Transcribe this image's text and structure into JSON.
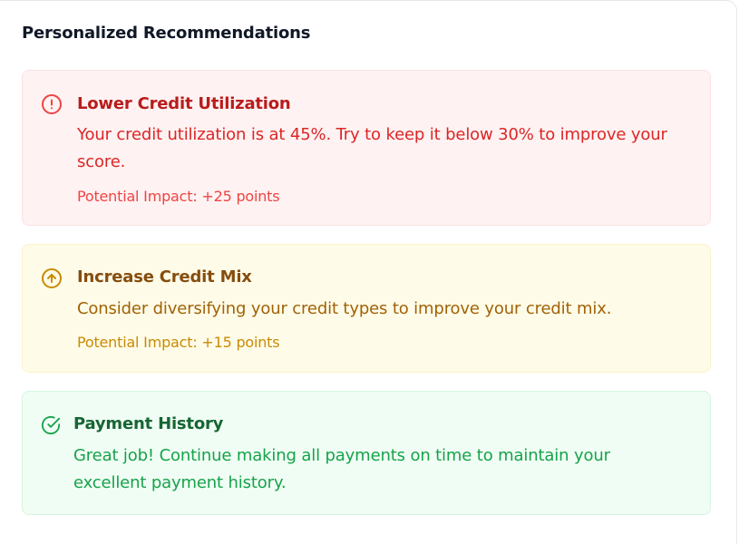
{
  "section": {
    "title": "Personalized Recommendations"
  },
  "recommendations": [
    {
      "icon": "alert-circle-icon",
      "title": "Lower Credit Utilization",
      "description": "Your credit utilization is at 45%. Try to keep it below 30% to improve your score.",
      "impact": "Potential Impact: +25 points",
      "color": "#dc2626"
    },
    {
      "icon": "arrow-up-circle-icon",
      "title": "Increase Credit Mix",
      "description": "Consider diversifying your credit types to improve your credit mix.",
      "impact": "Potential Impact: +15 points",
      "color": "#ca8a04"
    },
    {
      "icon": "check-circle-icon",
      "title": "Payment History",
      "description": "Great job! Continue making all payments on time to maintain your excellent payment history.",
      "color": "#16a34a"
    }
  ]
}
